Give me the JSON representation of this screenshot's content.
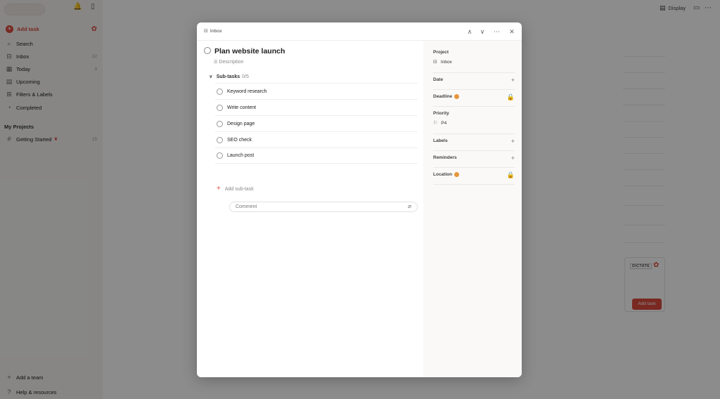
{
  "sidebar": {
    "add_task": "Add task",
    "items": [
      {
        "label": "Search",
        "icon": "search-icon",
        "count": ""
      },
      {
        "label": "Inbox",
        "icon": "inbox-icon",
        "count": "12"
      },
      {
        "label": "Today",
        "icon": "calendar-today-icon",
        "count": "3"
      },
      {
        "label": "Upcoming",
        "icon": "calendar-upcoming-icon",
        "count": ""
      },
      {
        "label": "Filters & Labels",
        "icon": "filters-icon",
        "count": ""
      },
      {
        "label": "Completed",
        "icon": "check-circle-icon",
        "count": ""
      }
    ],
    "projects_heading": "My Projects",
    "project": {
      "label": "Getting Started",
      "count": "15"
    },
    "add_team": "Add a team",
    "help": "Help & resources"
  },
  "topbar": {
    "display": "Display"
  },
  "dictate": {
    "label": "DICTATE",
    "button": "Add task"
  },
  "modal": {
    "breadcrumb": "Inbox",
    "task_title": "Plan website launch",
    "description_placeholder": "Description",
    "subtasks_label": "Sub-tasks",
    "subtasks_count": "0/5",
    "subtasks": [
      "Keyword research",
      "Write content",
      "Design page",
      "SEO check",
      "Launch post"
    ],
    "add_subtask": "Add sub-task",
    "comment_placeholder": "Comment",
    "props": {
      "project_label": "Project",
      "project_value": "Inbox",
      "date_label": "Date",
      "deadline_label": "Deadline",
      "priority_label": "Priority",
      "priority_value": "P4",
      "labels_label": "Labels",
      "reminders_label": "Reminders",
      "location_label": "Location"
    }
  },
  "colors": {
    "accent": "#dc4c3e",
    "upgrade": "#e8953a"
  }
}
